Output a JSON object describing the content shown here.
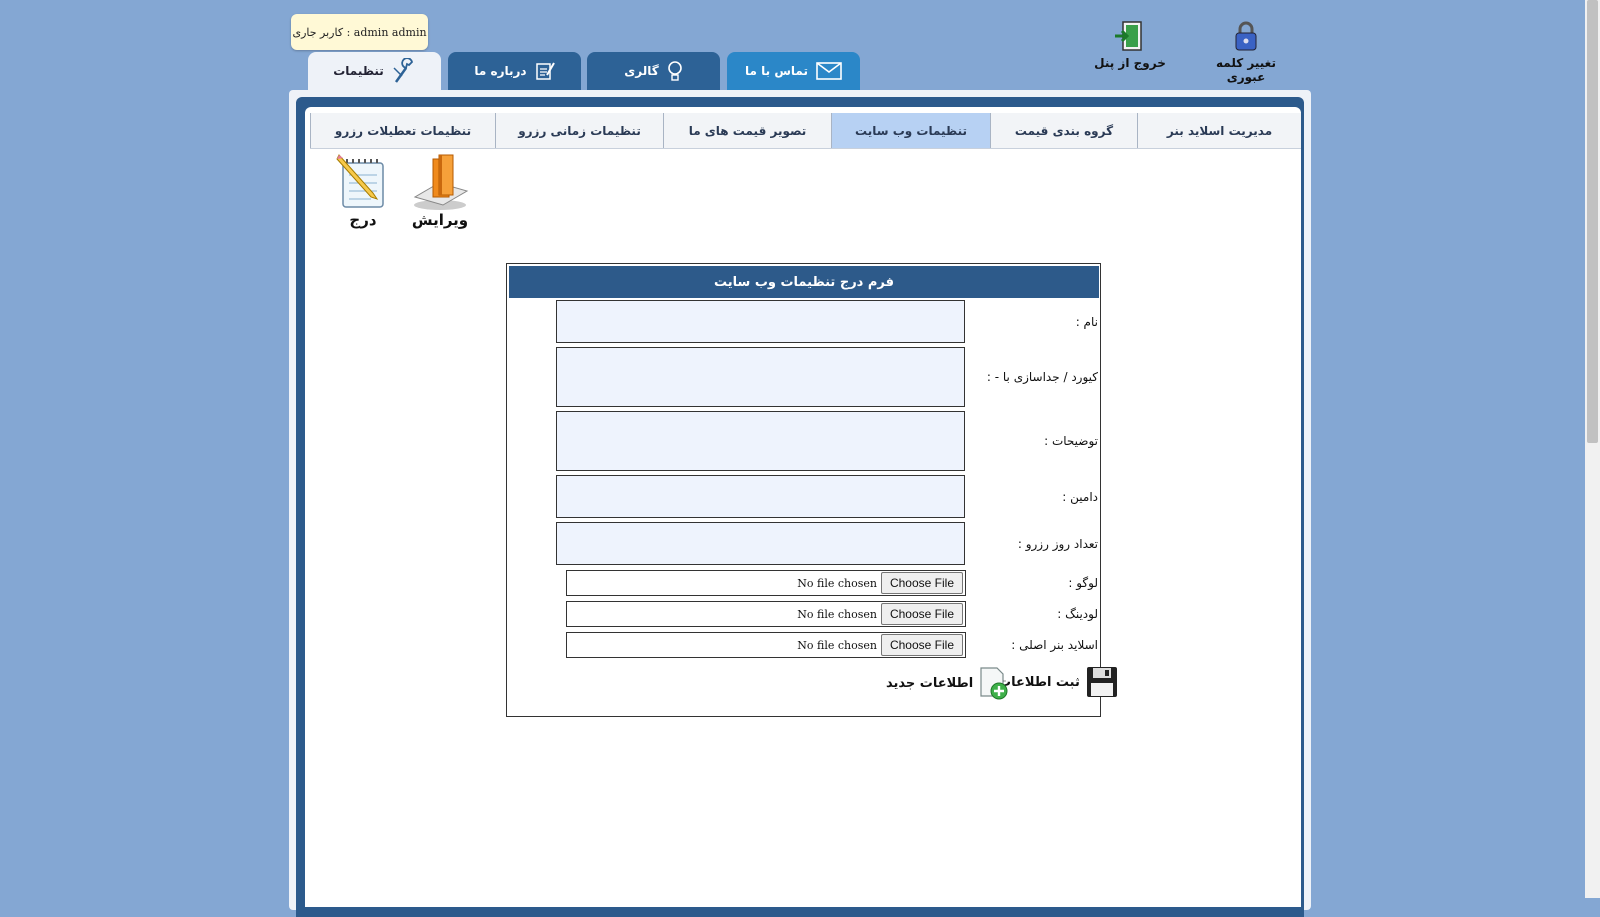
{
  "quick_actions": {
    "change_password": "تغییر کلمه عبوری",
    "logout": "خروج از پنل"
  },
  "user_badge": "admin admin : کاربر جاری",
  "main_tabs": [
    {
      "label": "تماس با ما",
      "icon": "envelope-icon"
    },
    {
      "label": "گالری",
      "icon": "lightbulb-icon"
    },
    {
      "label": "درباره ما",
      "icon": "notepad-pen-icon"
    },
    {
      "label": "تنظیمات",
      "icon": "wrench-icon"
    }
  ],
  "sub_tabs": [
    "مدیریت اسلاید بنر",
    "گروه بندی قیمت",
    "تنظیمات وب سایت",
    "تصویر قیمت های ما",
    "تنظیمات زمانی رزرو",
    "تنظیمات تعطیلات رزرو"
  ],
  "actions": {
    "edit": "ویرایش",
    "insert": "درج"
  },
  "form": {
    "title": "فرم درج تنظیمات وب سایت",
    "fields": {
      "name": "نام :",
      "keywords": "کیورد / جداسازی با - :",
      "description": "توضیحات :",
      "domain": "دامین :",
      "reserve_days": "تعداد روز رزرو :",
      "logo": "لوگو :",
      "loading": "لودینگ :",
      "main_banner": "اسلاید بنر اصلی :"
    },
    "file_button": "Choose File",
    "file_status": "No file chosen",
    "submit": "ثبت اطلاعات",
    "new_info": "اطلاعات جدید"
  },
  "colors": {
    "background": "#84a7d3",
    "tab_dark": "#2d6296",
    "tab_light": "#2b87c8",
    "panel_frame": "#2c5a8c",
    "subtab_active": "#b7d1f3"
  }
}
